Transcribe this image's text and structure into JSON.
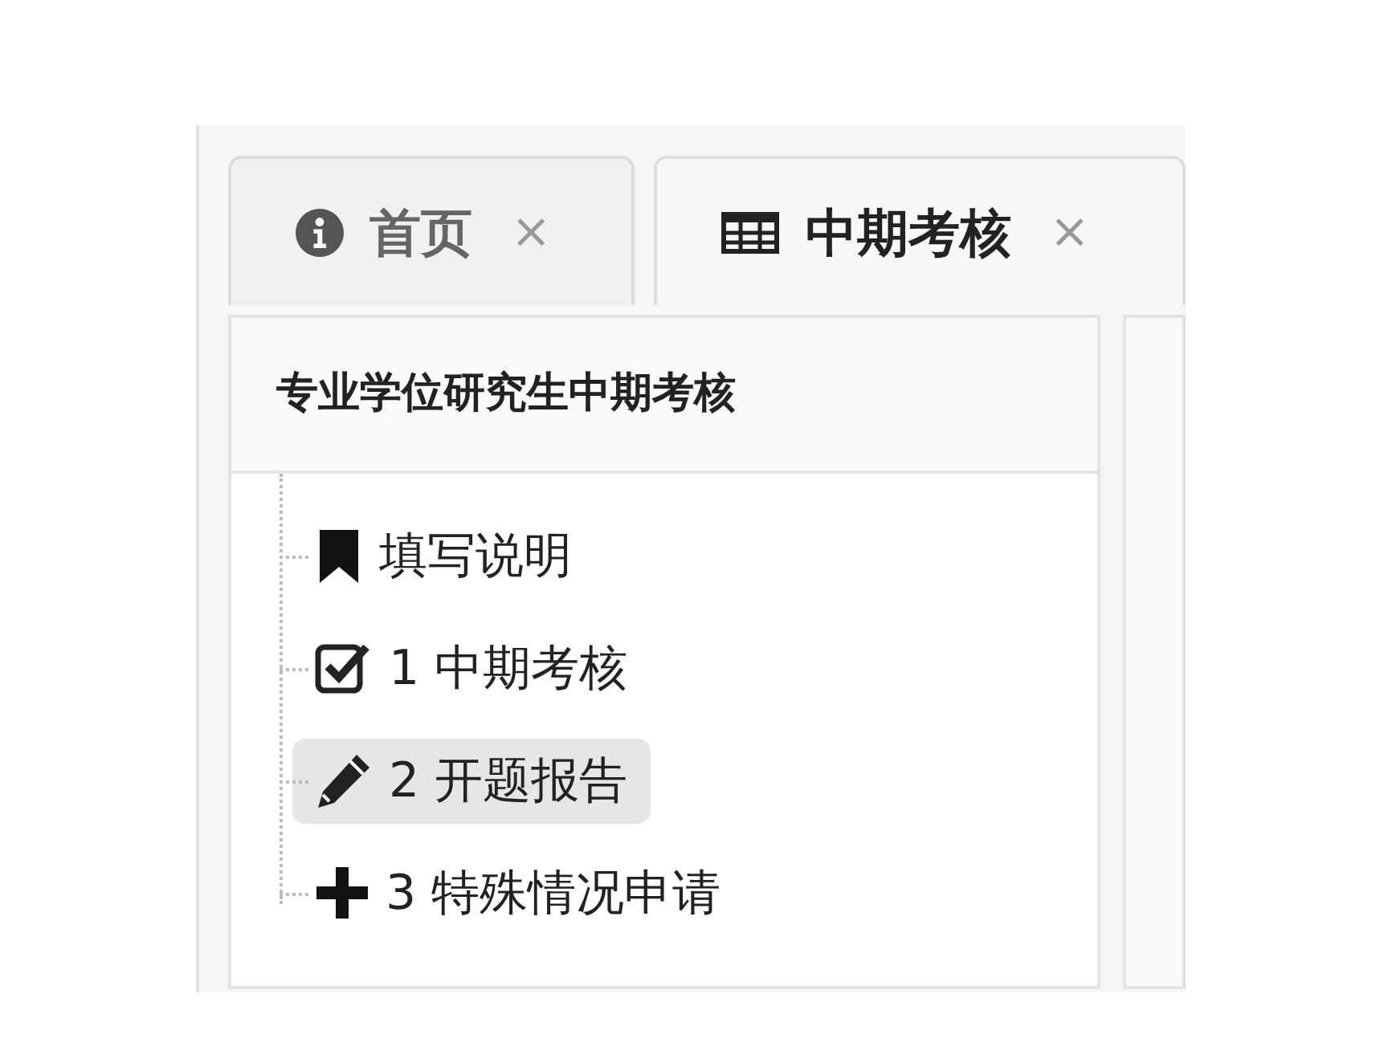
{
  "tabs": [
    {
      "label": "首页",
      "close": "×",
      "selected": false
    },
    {
      "label": "中期考核",
      "close": "×",
      "selected": true
    }
  ],
  "panel": {
    "title": "专业学位研究生中期考核",
    "items": [
      {
        "label": "填写说明",
        "selected": false
      },
      {
        "label": "1 中期考核",
        "selected": false
      },
      {
        "label": "2 开题报告",
        "selected": true
      },
      {
        "label": "3 特殊情况申请",
        "selected": false
      }
    ]
  }
}
